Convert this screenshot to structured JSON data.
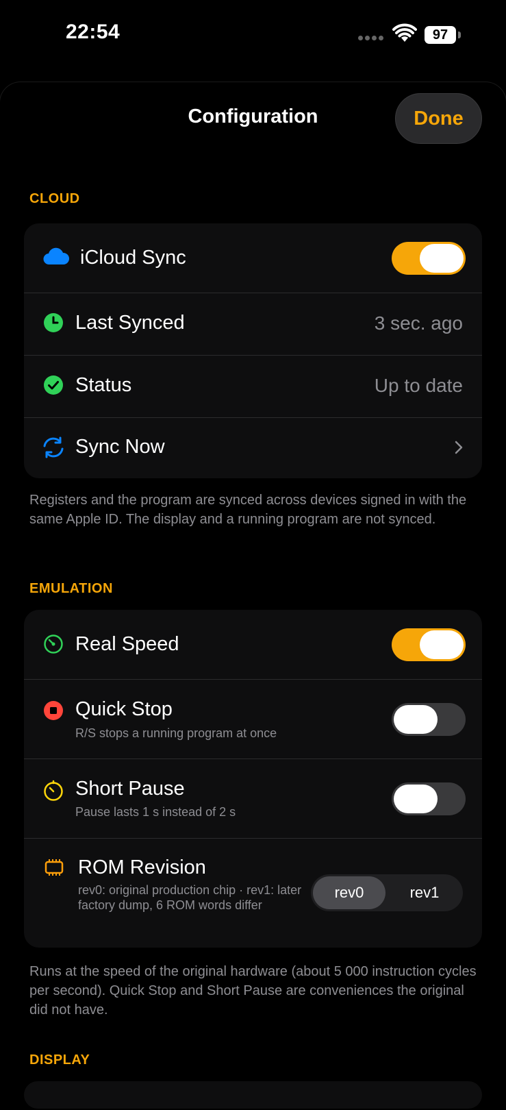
{
  "status_bar": {
    "time": "22:54",
    "battery": "97"
  },
  "nav": {
    "title": "Configuration",
    "done": "Done"
  },
  "cloud": {
    "header": "CLOUD",
    "rows": {
      "icloud_sync": {
        "label": "iCloud Sync",
        "toggle": true
      },
      "last_synced": {
        "label": "Last Synced",
        "value": "3 sec. ago"
      },
      "status": {
        "label": "Status",
        "value": "Up to date"
      },
      "sync_now": {
        "label": "Sync Now"
      }
    },
    "footer": "Registers and the program are synced across devices signed in with the same Apple ID. The display and a running program are not synced."
  },
  "emulation": {
    "header": "EMULATION",
    "rows": {
      "real_speed": {
        "label": "Real Speed",
        "toggle": true
      },
      "quick_stop": {
        "label": "Quick Stop",
        "sublabel": "R/S stops a running program at once",
        "toggle": false
      },
      "short_pause": {
        "label": "Short Pause",
        "sublabel": "Pause lasts 1 s instead of 2 s",
        "toggle": false
      },
      "rom_revision": {
        "label": "ROM Revision",
        "sublabel": "rev0: original production chip · rev1: later factory dump, 6 ROM words differ",
        "options": [
          "rev0",
          "rev1"
        ],
        "selected": "rev0"
      }
    },
    "footer": "Runs at the speed of the original hardware (about 5 000 instruction cycles per second). Quick Stop and Short Pause are conveniences the original did not have."
  },
  "display": {
    "header": "DISPLAY"
  },
  "colors": {
    "accent": "#f6a609",
    "green": "#30d158",
    "blue": "#0a84ff",
    "red": "#ff453a",
    "yellow": "#ffd60a",
    "orange": "#ff9f0a"
  }
}
